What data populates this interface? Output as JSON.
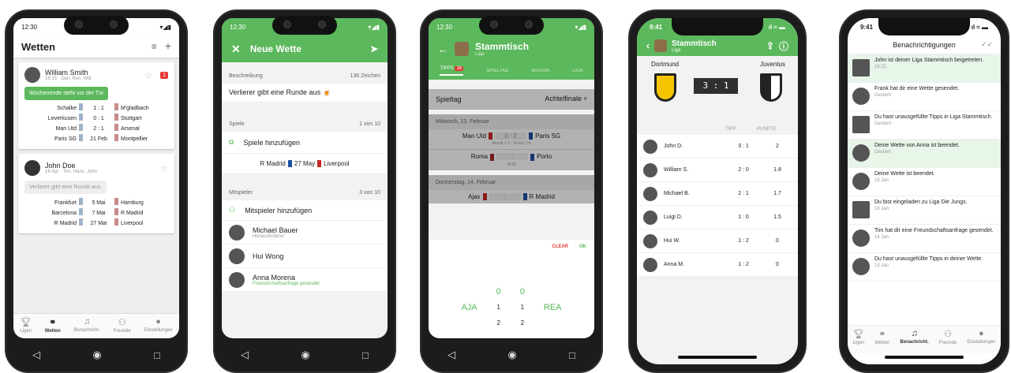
{
  "p1": {
    "time": "12:30",
    "title": "Wetten",
    "bets": [
      {
        "name": "William Smith",
        "meta": "16:15 · Dan, Ben, Will",
        "badge": "1",
        "bubble": "Wochenende steht vor der Tür",
        "matches": [
          [
            "Schalke",
            "1 : 1",
            "M'gladbach"
          ],
          [
            "Leverkusen",
            "0 : 1",
            "Stuttgart"
          ],
          [
            "Man Utd",
            "2 : 1",
            "Arsenal"
          ],
          [
            "Paris SG",
            "21 Feb",
            "Montpellier"
          ]
        ]
      },
      {
        "name": "John Doe",
        "meta": "16 Apr · Tim, Hans, John",
        "bubble": "Verlierer gibt eine Runde aus.",
        "matches": [
          [
            "Frankfurt",
            "5 Mai",
            "Hamburg"
          ],
          [
            "Barcelona",
            "7 Mai",
            "R Madrid"
          ],
          [
            "R Madrid",
            "27 Mai",
            "Liverpool"
          ]
        ]
      }
    ],
    "nav": [
      "Ligen",
      "Wetten",
      "Benachricht.",
      "Freunde",
      "Einstellungen"
    ]
  },
  "p2": {
    "time": "12:30",
    "title": "Neue Wette",
    "desc_label": "Beschreibung",
    "desc_count": "136 Zeichen",
    "desc": "Verlierer gibt eine Runde aus 🍺",
    "games_label": "Spiele",
    "games_count": "1 von 10",
    "add_games": "Spiele hinzufügen",
    "game": {
      "home": "R Madrid",
      "date": "27 May",
      "away": "Liverpool"
    },
    "players_label": "Mitspieler",
    "players_count": "3 von 10",
    "add_players": "Mitspieler hinzufügen",
    "players": [
      {
        "name": "Michael Bauer",
        "sub": "Herausforderer"
      },
      {
        "name": "Hui Wong",
        "sub": ""
      },
      {
        "name": "Anna Morena",
        "sub": "Freundschaftsanfrage gesendet"
      }
    ]
  },
  "p3": {
    "time": "12:30",
    "title": "Stammtisch",
    "subtitle": "Liga",
    "tabs": [
      "TIPPS",
      "SPIELTAG",
      "SAISON",
      "LIGA"
    ],
    "tips_badge": "16",
    "spieltag_label": "Spieltag",
    "spieltag": "Achtelfinale",
    "day1": "Mittwoch, 13. Februar",
    "m1": {
      "home": "Man Utd",
      "score": "0 : 2",
      "away": "Paris SG",
      "sub": "Result 1:3 · Points 1,8"
    },
    "m2": {
      "home": "Roma",
      "score": ":",
      "away": "Porto",
      "sub": "19:30"
    },
    "day2": "Donnerstag, 14. Februar",
    "m3": {
      "home": "Ajax",
      "score": ":",
      "away": "R Madrid"
    },
    "picker": {
      "clear": "CLEAR",
      "ok": "OK",
      "home": "AJA",
      "away": "REA",
      "col1": [
        "0",
        "1",
        "2"
      ],
      "col2": [
        "0",
        "1",
        "2"
      ]
    }
  },
  "p4": {
    "time": "9:41",
    "title": "Stammtisch",
    "subtitle": "Liga",
    "home": "Dortmund",
    "away": "Juventus",
    "score": "3 : 1",
    "col_tipp": "TIPP",
    "col_punkte": "PUNKTE",
    "rows": [
      [
        "John D.",
        "3 : 1",
        "2"
      ],
      [
        "William S.",
        "2 : 0",
        "1.8"
      ],
      [
        "Michael B.",
        "2 : 1",
        "1.7"
      ],
      [
        "Luigi D.",
        "1 : 0",
        "1.5"
      ],
      [
        "Hui W.",
        "1 : 2",
        "0"
      ],
      [
        "Anna M.",
        "1 : 2",
        "0"
      ]
    ]
  },
  "p5": {
    "time": "9:41",
    "title": "Benachrichtigungen",
    "items": [
      {
        "text": "John ist deiner Liga Stammtisch beigetreten.",
        "when": "16:22",
        "hl": true
      },
      {
        "text": "Frank hat dir eine Wette gesendet.",
        "when": "Gestern",
        "hl": false
      },
      {
        "text": "Du hast unausgefüllte Tipps in Liga Stammtisch.",
        "when": "Gestern",
        "hl": false
      },
      {
        "text": "Deine Wette von Anna ist beendet.",
        "when": "Gestern",
        "hl": true
      },
      {
        "text": "Deine Wette ist beendet.",
        "when": "18 Jan",
        "hl": false
      },
      {
        "text": "Du bist eingeladen zu Liga Die Jungs.",
        "when": "18 Jan",
        "hl": false
      },
      {
        "text": "Tim hat dir eine Freundschaftsanfrage gesendet.",
        "when": "14 Jan",
        "hl": false
      },
      {
        "text": "Du hast unausgefüllte Tipps in deiner Wette.",
        "when": "13 Jan",
        "hl": false
      }
    ],
    "nav": [
      "Ligen",
      "Wetten",
      "Benachricht.",
      "Freunde",
      "Einstellungen"
    ]
  },
  "colors": {
    "green": "#5cb85c",
    "red": "#e53935"
  }
}
